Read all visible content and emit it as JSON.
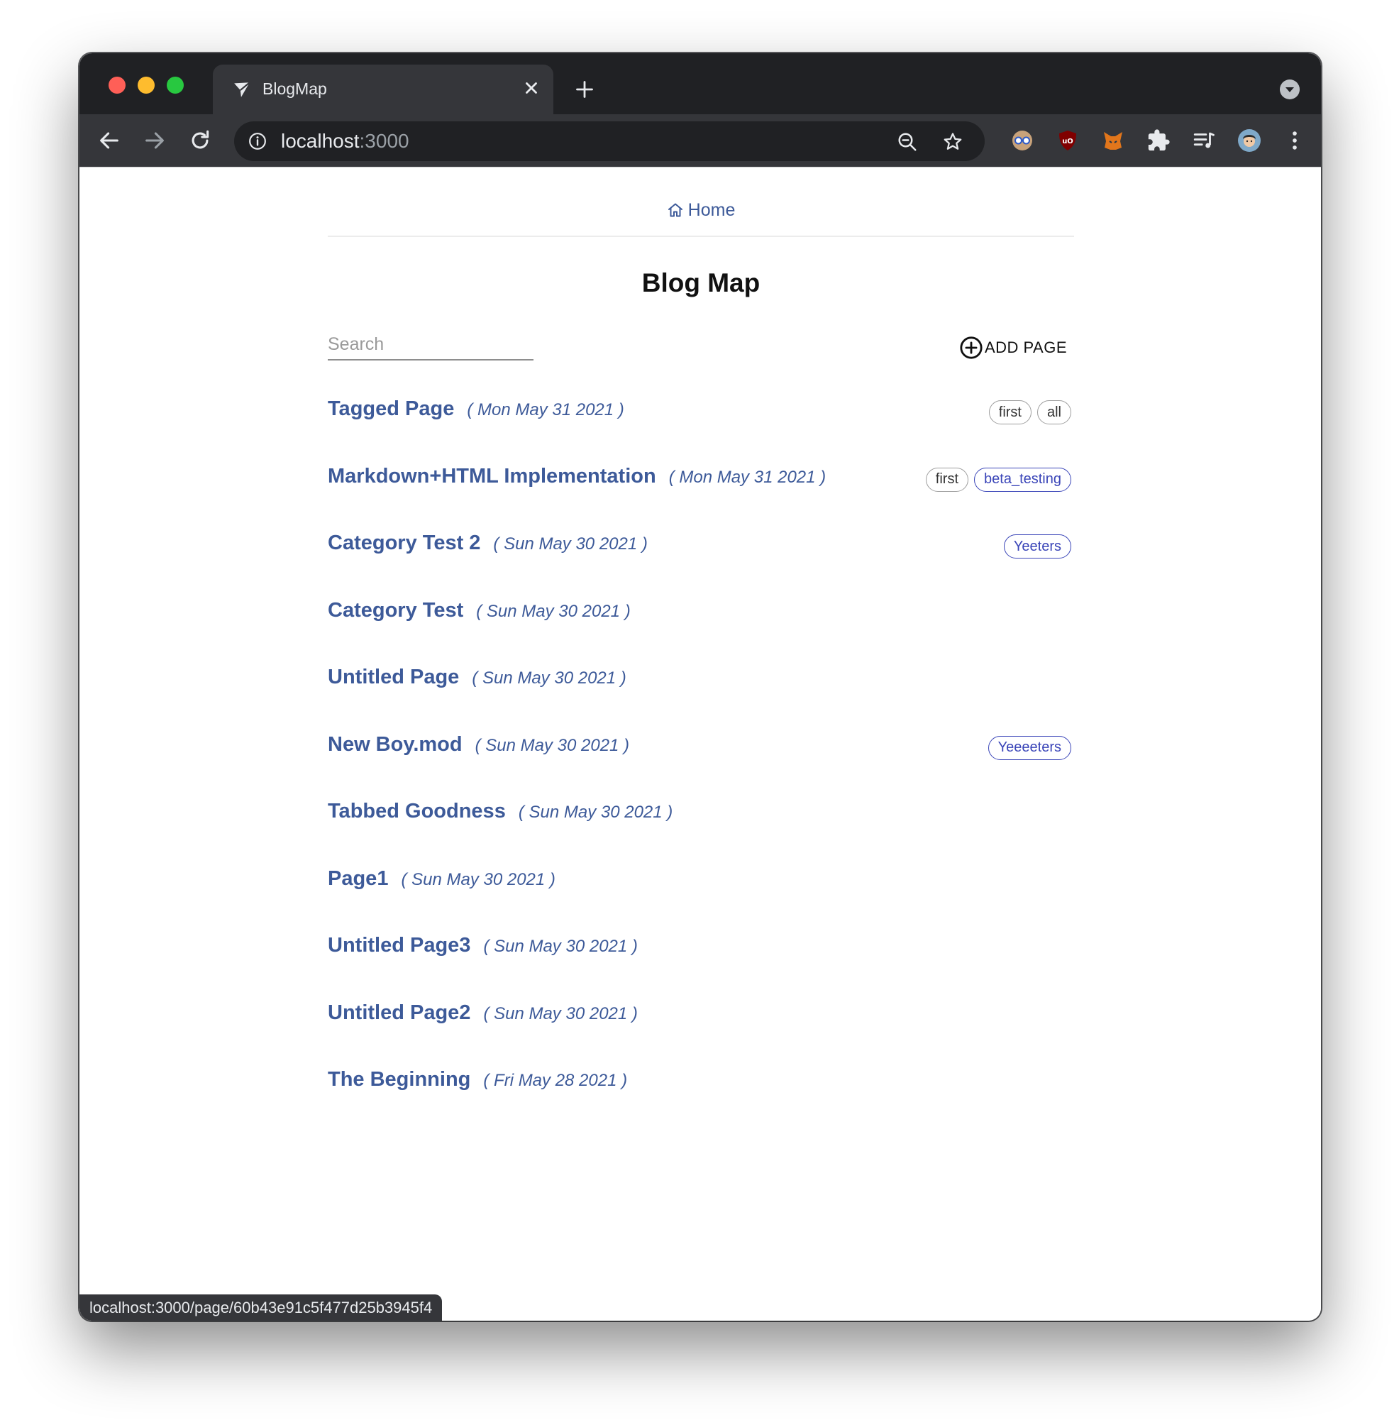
{
  "browser": {
    "tab_title": "BlogMap",
    "url_host": "localhost",
    "url_port": ":3000",
    "status_url": "localhost:3000/page/60b43e91c5f477d25b3945f4"
  },
  "nav": {
    "home_label": "Home"
  },
  "page": {
    "title": "Blog Map",
    "search_placeholder": "Search",
    "add_page_label": "ADD PAGE"
  },
  "posts": [
    {
      "title": "Tagged Page",
      "date": "( Mon May 31 2021 )",
      "tags": [
        {
          "label": "first",
          "style": "grey"
        },
        {
          "label": "all",
          "style": "grey"
        }
      ]
    },
    {
      "title": "Markdown+HTML Implementation",
      "date": "( Mon May 31 2021 )",
      "tags": [
        {
          "label": "first",
          "style": "grey"
        },
        {
          "label": "beta_testing",
          "style": "blue"
        }
      ]
    },
    {
      "title": "Category Test 2",
      "date": "( Sun May 30 2021 )",
      "tags": [
        {
          "label": "Yeeters",
          "style": "blue"
        }
      ]
    },
    {
      "title": "Category Test",
      "date": "( Sun May 30 2021 )",
      "tags": []
    },
    {
      "title": "Untitled Page",
      "date": "( Sun May 30 2021 )",
      "tags": []
    },
    {
      "title": "New Boy.mod",
      "date": "( Sun May 30 2021 )",
      "tags": [
        {
          "label": "Yeeeeters",
          "style": "blue"
        }
      ]
    },
    {
      "title": "Tabbed Goodness",
      "date": "( Sun May 30 2021 )",
      "tags": []
    },
    {
      "title": "Page1",
      "date": "( Sun May 30 2021 )",
      "tags": []
    },
    {
      "title": "Untitled Page3",
      "date": "( Sun May 30 2021 )",
      "tags": []
    },
    {
      "title": "Untitled Page2",
      "date": "( Sun May 30 2021 )",
      "tags": []
    },
    {
      "title": "The Beginning",
      "date": "( Fri May 28 2021 )",
      "tags": []
    }
  ],
  "colors": {
    "link": "#3d5a99",
    "tag_blue": "#3a45b8",
    "chrome_dark": "#202124",
    "chrome_toolbar": "#35363a"
  }
}
